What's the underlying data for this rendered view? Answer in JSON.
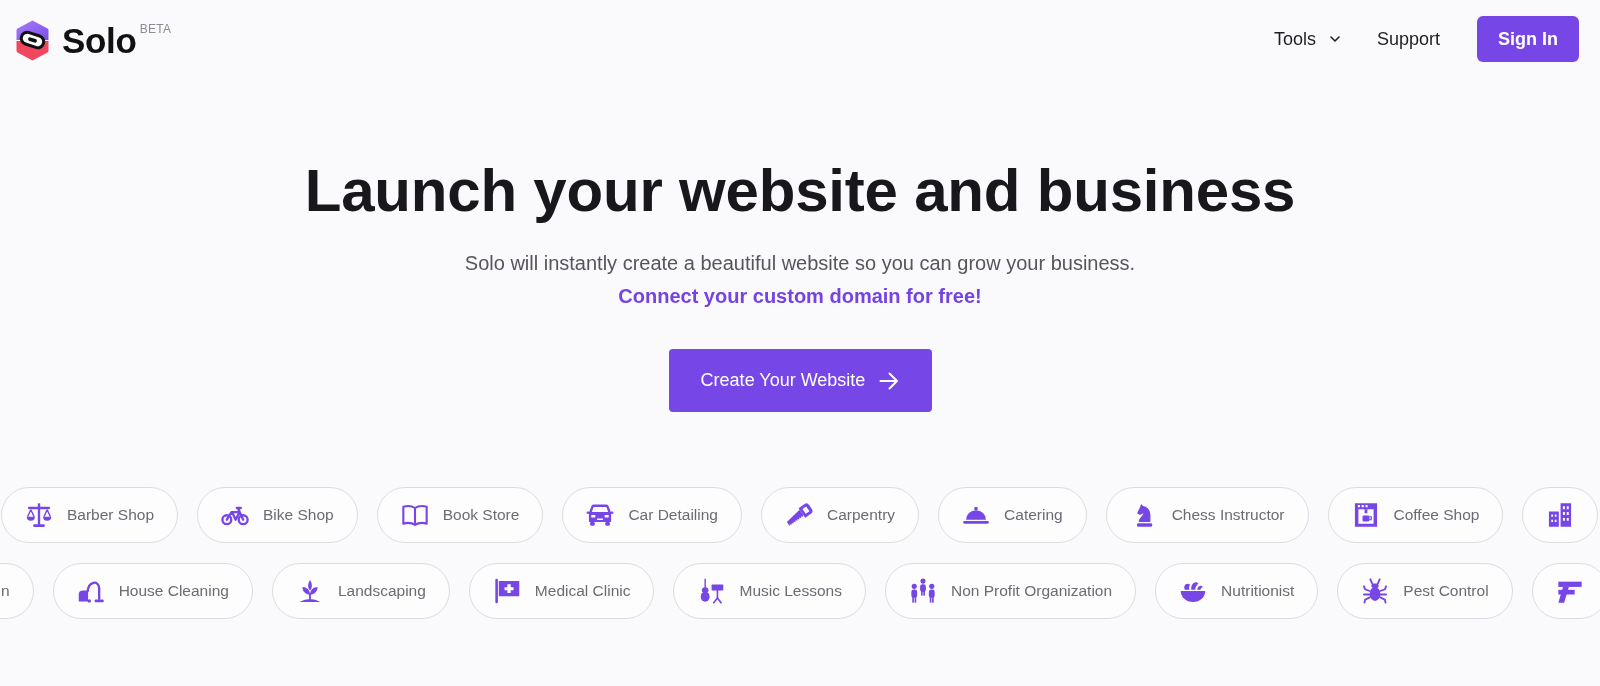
{
  "header": {
    "logo": {
      "name": "Solo",
      "badge": "BETA"
    },
    "nav": [
      {
        "label": "Tools",
        "kind": "dropdown"
      },
      {
        "label": "Support",
        "kind": "link"
      }
    ],
    "sign_in": "Sign In"
  },
  "hero": {
    "title": "Launch your website and business",
    "subtitle": "Solo will instantly create a beautiful website so you can grow your business.",
    "highlight": "Connect your custom domain for free!",
    "cta": "Create Your Website"
  },
  "categories": [
    {
      "chips": [
        {
          "kind": "full",
          "label": "Barber Shop"
        },
        {
          "kind": "full",
          "label": "Bike Shop"
        },
        {
          "kind": "full",
          "label": "Book Store"
        },
        {
          "kind": "full",
          "label": "Car Detailing"
        },
        {
          "kind": "full",
          "label": "Carpentry"
        },
        {
          "kind": "full",
          "label": "Catering"
        },
        {
          "kind": "full",
          "label": "Chess Instructor"
        },
        {
          "kind": "full",
          "label": "Coffee Shop"
        },
        {
          "kind": "cut_right"
        }
      ]
    },
    {
      "chips": [
        {
          "kind": "cut_left",
          "label": "n"
        },
        {
          "kind": "full",
          "label": "House Cleaning"
        },
        {
          "kind": "full",
          "label": "Landscaping"
        },
        {
          "kind": "full",
          "label": "Medical Clinic"
        },
        {
          "kind": "full",
          "label": "Music Lessons"
        },
        {
          "kind": "full",
          "label": "Non Profit Organization"
        },
        {
          "kind": "full",
          "label": "Nutritionist"
        },
        {
          "kind": "full",
          "label": "Pest Control"
        },
        {
          "kind": "cut_right"
        }
      ]
    }
  ]
}
